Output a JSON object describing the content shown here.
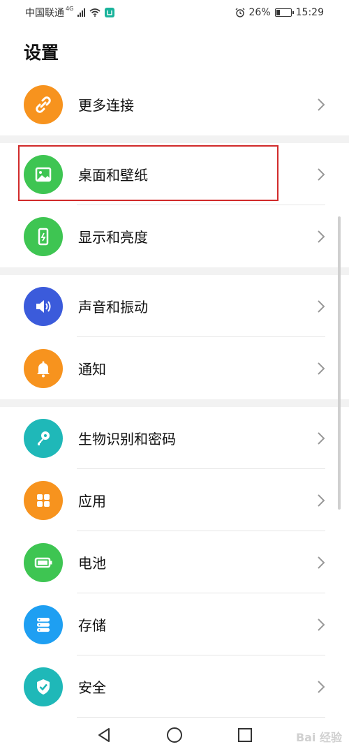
{
  "status_bar": {
    "carrier": "中国联通",
    "network": "4G",
    "battery_percent": "26%",
    "time": "15:29",
    "battery_level": 0.26
  },
  "page": {
    "title": "设置"
  },
  "items": [
    {
      "label": "更多连接",
      "icon": "link-icon",
      "color": "#f7931e"
    },
    {
      "label": "桌面和壁纸",
      "icon": "image-icon",
      "color": "#3ec552"
    },
    {
      "label": "显示和亮度",
      "icon": "phone-brightness-icon",
      "color": "#3ec552"
    },
    {
      "label": "声音和振动",
      "icon": "volume-icon",
      "color": "#3b5bdb"
    },
    {
      "label": "通知",
      "icon": "bell-icon",
      "color": "#f7931e"
    },
    {
      "label": "生物识别和密码",
      "icon": "key-icon",
      "color": "#1fb8b8"
    },
    {
      "label": "应用",
      "icon": "apps-grid-icon",
      "color": "#f7931e"
    },
    {
      "label": "电池",
      "icon": "battery-icon",
      "color": "#3ec552"
    },
    {
      "label": "存储",
      "icon": "storage-icon",
      "color": "#1e9ff2"
    },
    {
      "label": "安全",
      "icon": "shield-check-icon",
      "color": "#1fb8b8"
    }
  ],
  "watermark": "Bai 经验"
}
